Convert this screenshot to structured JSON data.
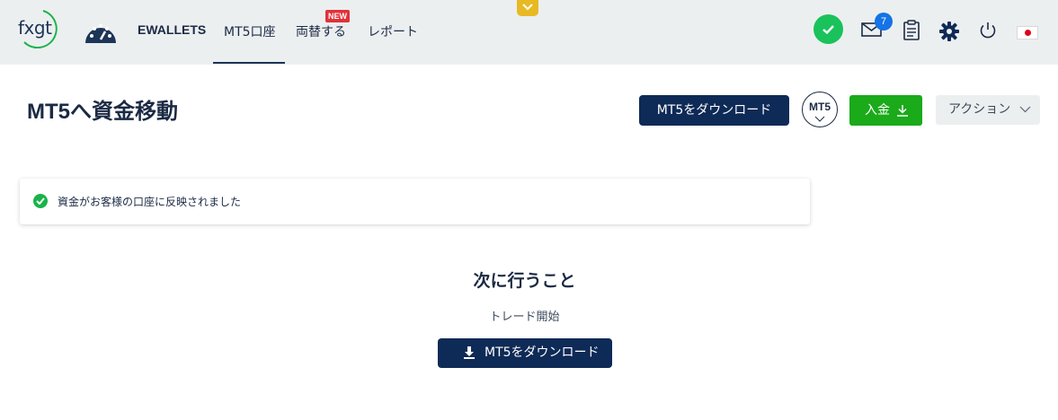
{
  "nav": {
    "logo": "fxgt",
    "items": [
      {
        "label": "EWALLETS"
      },
      {
        "label": "MT5口座"
      },
      {
        "label": "両替する"
      },
      {
        "label": "レポート"
      }
    ],
    "new_badge": "NEW",
    "mail_count": "7",
    "icons": [
      "dashboard-gauge-icon",
      "verified-check-icon",
      "mail-icon",
      "clipboard-icon",
      "gear-icon",
      "power-icon",
      "japan-flag-icon",
      "chevron-down-icon"
    ],
    "colors": {
      "bar": "#eceff0",
      "collapse_tab": "#e8b923",
      "ok": "#19c25b",
      "badge": "#1473e6",
      "new": "#e0323a"
    }
  },
  "header": {
    "title": "MT5へ資金移動",
    "download_label": "MT5をダウンロード",
    "platform_label": "MT5",
    "deposit_label": "入金",
    "action_label": "アクション",
    "colors": {
      "primary": "#0e2a56",
      "deposit": "#1aaa1a"
    }
  },
  "alert": {
    "message": "資金がお客様の口座に反映されました",
    "color": "#19b34a"
  },
  "next": {
    "title": "次に行うこと",
    "subtitle": "トレード開始",
    "download_label": "MT5をダウンロード"
  }
}
